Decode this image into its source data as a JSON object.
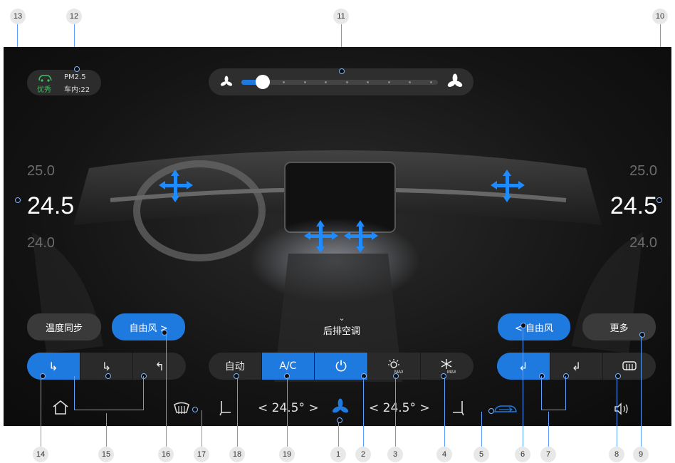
{
  "callouts": [
    "13",
    "12",
    "11",
    "10",
    "14",
    "15",
    "16",
    "17",
    "18",
    "19",
    "1",
    "2",
    "3",
    "4",
    "5",
    "6",
    "7",
    "8",
    "9"
  ],
  "air_quality": {
    "status": "优秀",
    "pm_label": "PM2.5",
    "inside": "车内:22"
  },
  "fan": {
    "level": 1,
    "max": 9
  },
  "left_temp": {
    "upper": "25.0",
    "current": "24.5",
    "lower": "24.0"
  },
  "right_temp": {
    "upper": "25.0",
    "current": "24.5",
    "lower": "24.0"
  },
  "labels": {
    "temp_sync": "温度同步",
    "free_air_left": "自由风 >",
    "rear_ac": "后排空调",
    "free_air_right": "< 自由风",
    "more": "更多"
  },
  "center_buttons": {
    "auto": "自动",
    "ac": "A/C",
    "power": "⏻"
  },
  "bottom": {
    "left_temp": "< 24.5° >",
    "right_temp": "< 24.5° >"
  },
  "colors": {
    "accent": "#1f7ae0",
    "good": "#3cc463"
  }
}
